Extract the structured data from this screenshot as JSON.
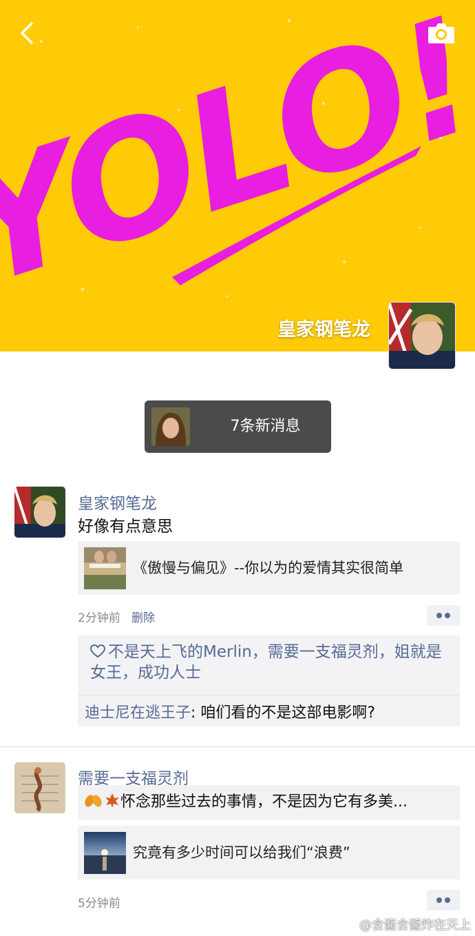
{
  "header": {
    "back_label": "back",
    "camera_label": "camera",
    "cover_text": "YOLO!",
    "profile_name": "皇家钢笔龙"
  },
  "new_messages": {
    "label": "7条新消息"
  },
  "posts": [
    {
      "author": "皇家钢笔龙",
      "text": "好像有点意思",
      "link_title": "《傲慢与偏见》--你以为的爱情其实很简单",
      "time": "2分钟前",
      "delete_label": "删除",
      "likes": "不是天上飞的Merlin，需要一支福灵剂，姐就是女王，成功人士",
      "comments": [
        {
          "author": "迪士尼在逃王子",
          "separator": ": ",
          "text": "咱们看的不是这部电影啊?"
        }
      ]
    },
    {
      "author": "需要一支福灵剂",
      "quote_text": "怀念那些过去的事情，不是因为它有多美...",
      "link_title": "究竟有多少时间可以给我们“浪费”",
      "time": "5分钟前"
    }
  ],
  "watermark": "@含酱含酱炸在天上",
  "colors": {
    "cover_background": "#fecb06",
    "cover_lettering": "#e81ee0",
    "link_blue": "#576b95",
    "pill_background": "#4b4b4b"
  }
}
